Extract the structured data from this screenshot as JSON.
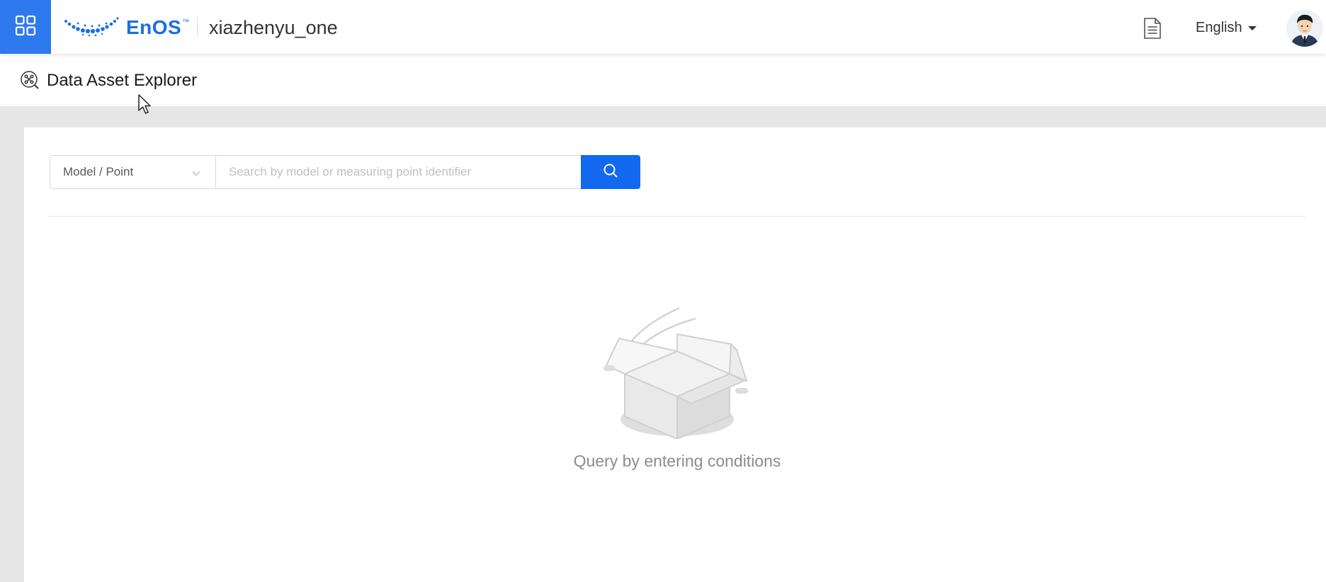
{
  "topbar": {
    "logo_text": "EnOS",
    "logo_trademark": "™",
    "org_name": "xiazhenyu_one",
    "language": "English",
    "icons": {
      "app_menu": "grid-icon",
      "docs": "document-icon",
      "avatar": "user-avatar"
    }
  },
  "page": {
    "title": "Data Asset Explorer",
    "icon": "data-explorer-icon"
  },
  "search": {
    "type_selected": "Model / Point",
    "placeholder": "Search by model or measuring point identifier",
    "value": "",
    "button_icon": "search-icon"
  },
  "empty_state": {
    "message": "Query by entering conditions",
    "icon": "empty-box-icon"
  },
  "colors": {
    "brand_blue": "#1269f0",
    "app_menu_blue": "#2f79ee",
    "logo_blue": "#1a6ee6"
  }
}
